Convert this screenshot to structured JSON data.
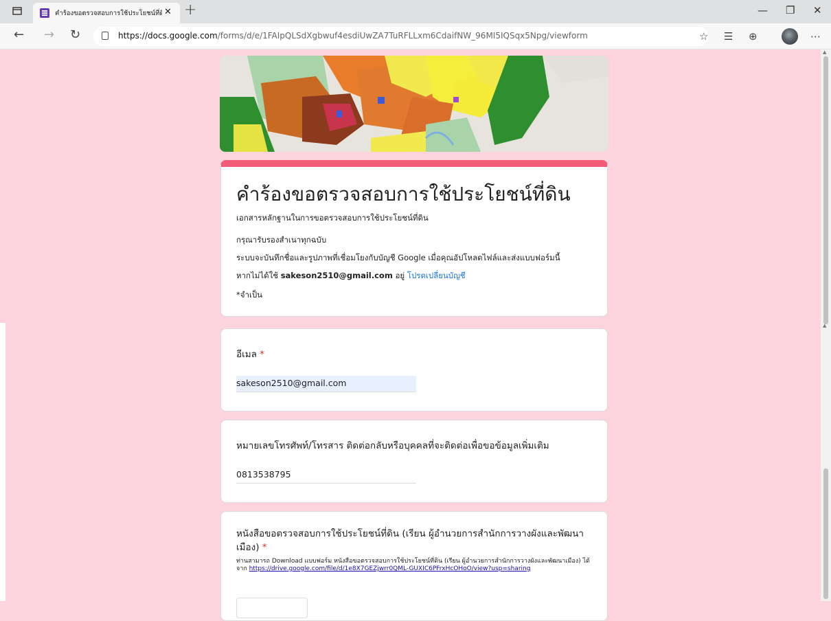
{
  "browser": {
    "tab_title": "คำร้องขอตรวจสอบการใช้ประโยชน์ที่ดิ",
    "url_host": "https://docs.google.com",
    "url_path": "/forms/d/e/1FAIpQLSdXgbwuf4esdiUwZA7TuRFLLxm6CdaifNW_96MI5IQSqx5Npg/viewform",
    "icons": [
      "sidebar-icon",
      "forms-favicon",
      "close-icon",
      "new-tab-icon",
      "minimize-icon",
      "restore-icon",
      "window-close-icon",
      "back-icon",
      "forward-icon",
      "refresh-icon",
      "lock-icon",
      "favorite-add-icon",
      "favorites-icon",
      "collections-icon",
      "profile-avatar",
      "more-icon"
    ]
  },
  "form": {
    "title": "คำร้องขอตรวจสอบการใช้ประโยชน์ที่ดิน",
    "description": "เอกสารหลักฐานในการขอตรวจสอบการใช้ประโยชน์ที่ดิน",
    "notice": "กรุณารับรองสำเนาทุกฉบับ",
    "record_notice": "ระบบจะบันทึกชื่อและรูปภาพที่เชื่อมโยงกับบัญชี Google เมื่อคุณอัปโหลดไฟล์และส่งแบบฟอร์มนี้",
    "account_prefix": "หากไม่ได้ใช้",
    "account_email": "sakeson2510@gmail.com",
    "account_middle": "อยู่",
    "switch_account": "โปรดเปลี่ยนบัญชี",
    "required_note": "*จำเป็น",
    "accent_color": "#f25c78",
    "background_color": "#fdd3dd"
  },
  "questions": {
    "email": {
      "label": "อีเมล",
      "required": "*",
      "value": "sakeson2510@gmail.com"
    },
    "phone": {
      "label": "หมายเลขโทรศัพท์/โทรสาร ติดต่อกลับหรือบุคคลที่จะติดต่อเพื่อขอข้อมูลเพิ่มเติม",
      "value": "0813538795"
    },
    "letter": {
      "label": "หนังสือขอตรวจสอบการใช้ประโยชน์ที่ดิน (เรียน ผู้อำนวยการสำนักการวางผังและพัฒนาเมือง)",
      "required": "*",
      "help_text": "ท่านสามารถ Download แบบฟอร์ม หนังสือขอตรวจสอบการใช้ประโยชน์ที่ดิน (เรียน ผู้อำนวยการสำนักการวางผังและพัฒนาเมือง) ได้จาก",
      "help_link": "https://drive.google.com/file/d/1e8X7GEZjwrr0QML-GUXIC6PFrxHcOHoO/view?usp=sharing"
    }
  }
}
